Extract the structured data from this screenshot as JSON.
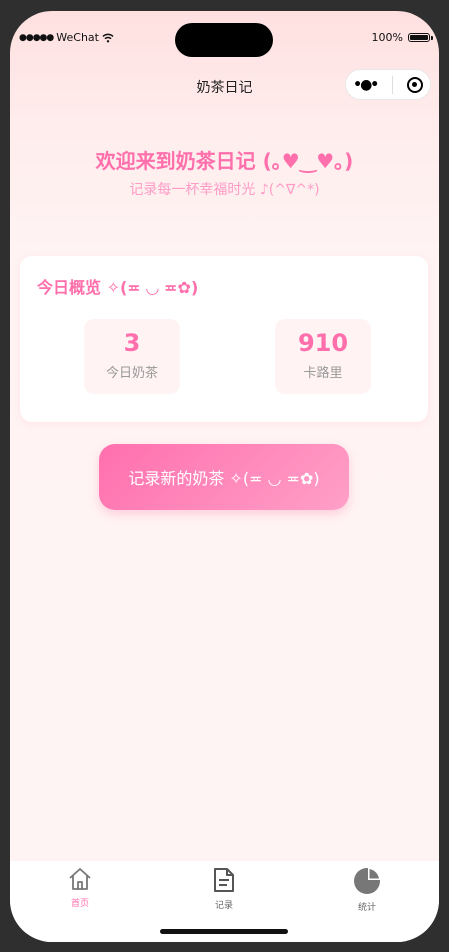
{
  "status_bar": {
    "carrier": "WeChat",
    "battery": "100%"
  },
  "nav": {
    "title": "奶茶日记"
  },
  "welcome": {
    "title": "欢迎来到奶茶日记 (｡♥‿♥｡)",
    "subtitle": "记录每一杯幸福时光 ♪(^∇^*)"
  },
  "overview": {
    "title": "今日概览 ✧(≖ ◡ ≖✿)",
    "stats": [
      {
        "value": "3",
        "label": "今日奶茶"
      },
      {
        "value": "910",
        "label": "卡路里"
      }
    ]
  },
  "record_button": {
    "label": "记录新的奶茶 ✧(≖ ◡ ≖✿)"
  },
  "tabbar": {
    "items": [
      {
        "label": "首页",
        "icon": "home-icon",
        "active": true
      },
      {
        "label": "记录",
        "icon": "document-icon",
        "active": false
      },
      {
        "label": "统计",
        "icon": "pie-chart-icon",
        "active": false
      }
    ]
  },
  "colors": {
    "accent": "#ff6fab",
    "tab_active": "#ff6fab",
    "tab_inactive": "#777777"
  }
}
